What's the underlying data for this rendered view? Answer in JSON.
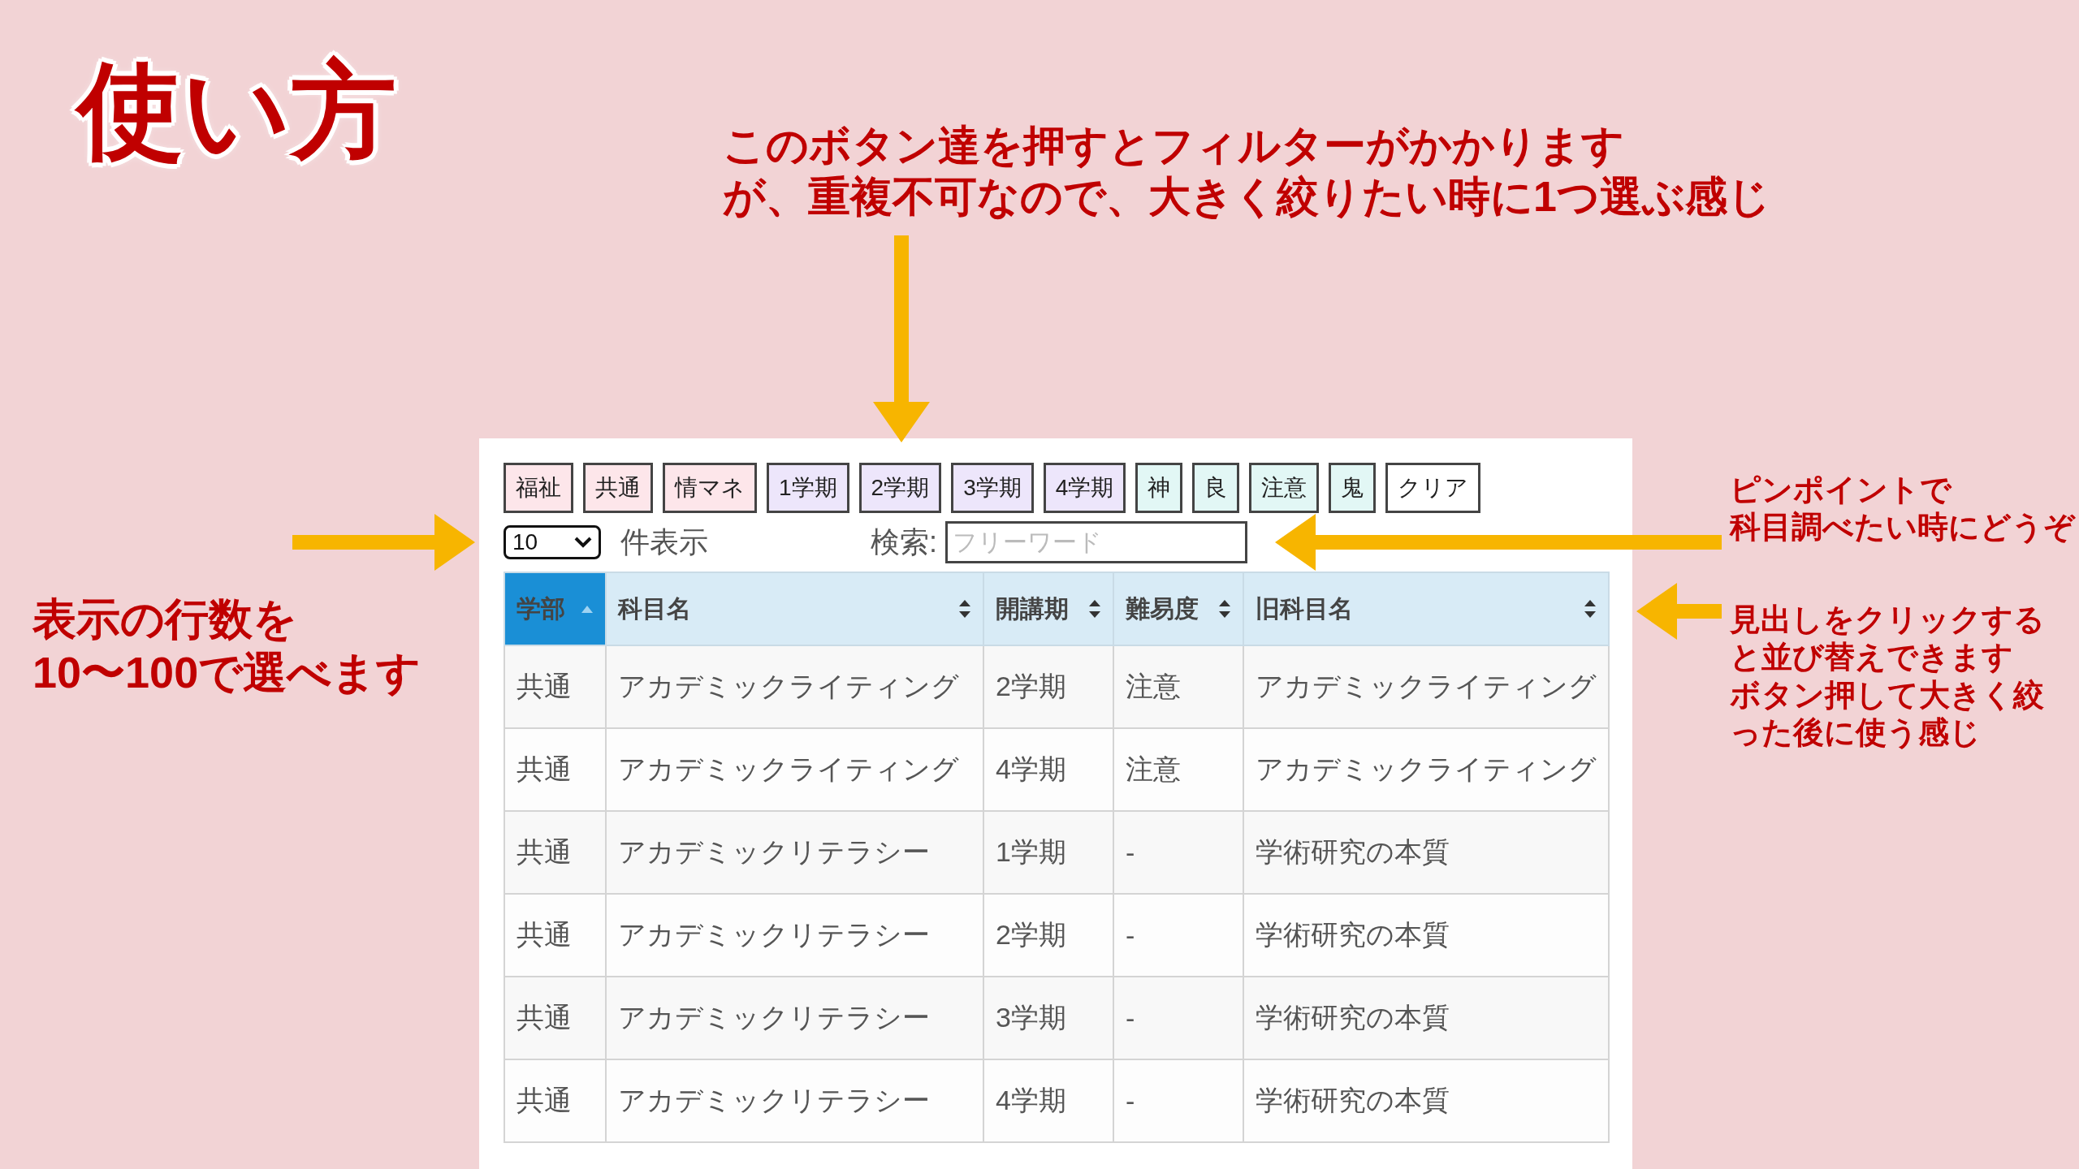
{
  "title": "使い方",
  "notes": [
    {
      "lines": [
        "このボタン達を押すとフィルターがかかります",
        "が、重複不可なので、大きく絞りたい時に1つ選ぶ感じ"
      ]
    },
    {
      "lines": [
        "ピンポイントで",
        "科目調べたい時にどうぞ"
      ]
    },
    {
      "lines": [
        "表示の行数を",
        "10〜100で選べます"
      ]
    },
    {
      "lines": [
        "見出しをクリックすると並び替えできます",
        "ボタン押して大きく絞った後に使う感じ"
      ]
    }
  ],
  "filter_buttons": [
    {
      "label": "福祉",
      "color": "#fde6ea"
    },
    {
      "label": "共通",
      "color": "#fde6ea"
    },
    {
      "label": "情マネ",
      "color": "#fde6ea"
    },
    {
      "label": "1学期",
      "color": "#ede6fb"
    },
    {
      "label": "2学期",
      "color": "#ede6fb"
    },
    {
      "label": "3学期",
      "color": "#ede6fb"
    },
    {
      "label": "4学期",
      "color": "#ede6fb"
    },
    {
      "label": "神",
      "color": "#e2f7f5"
    },
    {
      "label": "良",
      "color": "#e2f7f5"
    },
    {
      "label": "注意",
      "color": "#e2f7f5"
    },
    {
      "label": "鬼",
      "color": "#e2f7f5"
    },
    {
      "label": "クリア",
      "color": "#ffffff"
    }
  ],
  "page_length": {
    "value": "10",
    "label": "件表示"
  },
  "search": {
    "label": "検索:",
    "placeholder": "フリーワード"
  },
  "table": {
    "columns": [
      {
        "label": "学部",
        "selected": true
      },
      {
        "label": "科目名",
        "selected": false
      },
      {
        "label": "開講期",
        "selected": false
      },
      {
        "label": "難易度",
        "selected": false
      },
      {
        "label": "旧科目名",
        "selected": false
      }
    ],
    "rows": [
      [
        "共通",
        "アカデミックライティング",
        "2学期",
        "注意",
        "アカデミックライティング"
      ],
      [
        "共通",
        "アカデミックライティング",
        "4学期",
        "注意",
        "アカデミックライティング"
      ],
      [
        "共通",
        "アカデミックリテラシー",
        "1学期",
        "-",
        "学術研究の本質"
      ],
      [
        "共通",
        "アカデミックリテラシー",
        "2学期",
        "-",
        "学術研究の本質"
      ],
      [
        "共通",
        "アカデミックリテラシー",
        "3学期",
        "-",
        "学術研究の本質"
      ],
      [
        "共通",
        "アカデミックリテラシー",
        "4学期",
        "-",
        "学術研究の本質"
      ]
    ]
  }
}
